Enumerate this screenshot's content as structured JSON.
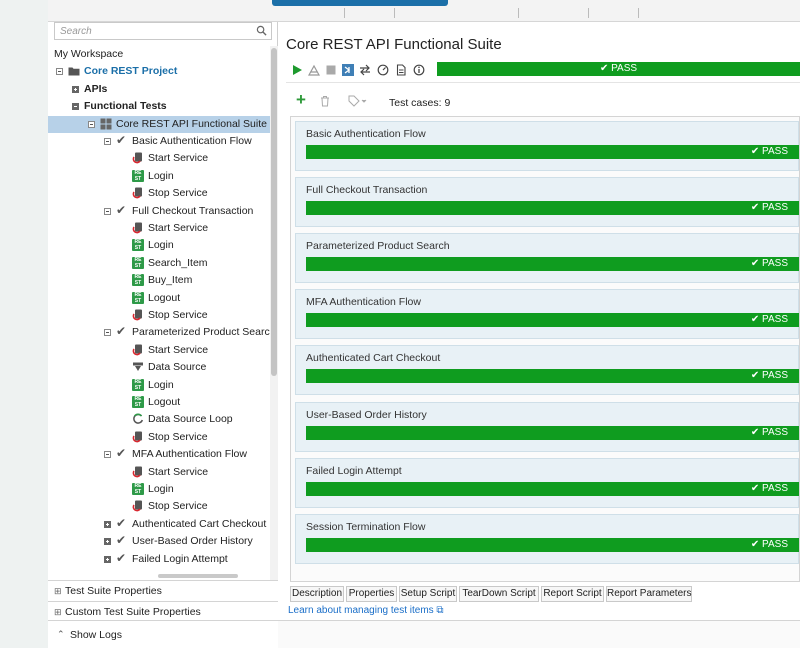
{
  "search": {
    "placeholder": "Search"
  },
  "tree": {
    "workspace": "My Workspace",
    "project": "Core REST Project",
    "apis": "APIs",
    "functional_tests": "Functional Tests",
    "suite": "Core REST API Functional Suite",
    "cases": [
      {
        "name": "Basic Authentication Flow",
        "steps": [
          "Start Service",
          "Login",
          "Stop Service"
        ]
      },
      {
        "name": "Full Checkout Transaction",
        "steps": [
          "Start Service",
          "Login",
          "Search_Item",
          "Buy_Item",
          "Logout",
          "Stop Service"
        ]
      },
      {
        "name": "Parameterized Product Search",
        "steps": [
          "Start Service",
          "Data Source",
          "Login",
          "Logout",
          "Data Source Loop",
          "Stop Service"
        ]
      },
      {
        "name": "MFA Authentication Flow",
        "steps": [
          "Start Service",
          "Login",
          "Stop Service"
        ]
      },
      {
        "name": "Authenticated Cart Checkout"
      },
      {
        "name": "User-Based Order History"
      },
      {
        "name": "Failed Login Attempt"
      }
    ]
  },
  "left_sections": {
    "suite_props": "Test Suite Properties",
    "custom_props": "Custom Test Suite Properties",
    "show_logs": "Show Logs"
  },
  "main": {
    "title": "Core REST API Functional Suite",
    "status": "✔ PASS",
    "test_cases_label": "Test cases: 9",
    "case_status": "✔ PASS",
    "cases": [
      "Basic Authentication Flow",
      "Full Checkout Transaction",
      "Parameterized Product Search",
      "MFA Authentication Flow",
      "Authenticated Cart Checkout",
      "User-Based Order History",
      "Failed Login Attempt",
      "Session Termination Flow"
    ],
    "tabs": [
      "Description",
      "Properties",
      "Setup Script",
      "TearDown Script",
      "Report Script",
      "Report Parameters"
    ],
    "learn_link": "Learn about managing test items ⧉"
  },
  "colors": {
    "pass_green": "#0f9c1f",
    "selection": "#b7d1e8",
    "accent_blue": "#1b6fa8",
    "link": "#1a6ec8"
  }
}
